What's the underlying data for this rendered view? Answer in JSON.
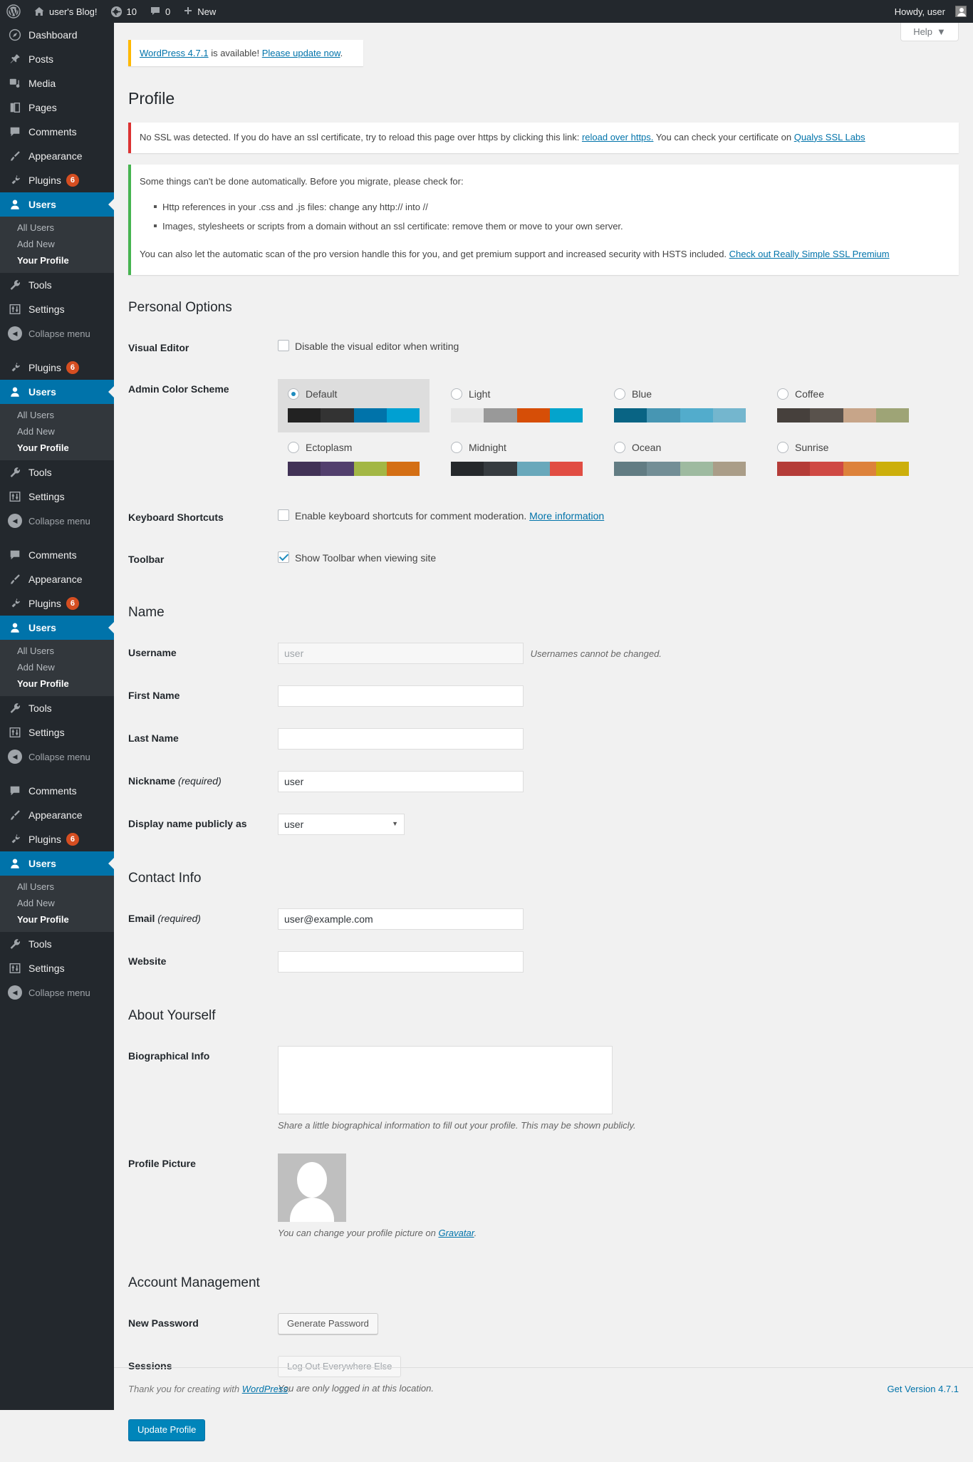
{
  "adminbar": {
    "site_name": "user's Blog!",
    "updates_count": "10",
    "comments_count": "0",
    "new_label": "New",
    "howdy": "Howdy, user"
  },
  "help_tab": {
    "label": "Help"
  },
  "sidebar": {
    "blocks": [
      {
        "items": [
          {
            "label": "Dashboard",
            "icon": "dashboard-icon",
            "current": false
          },
          {
            "label": "Posts",
            "icon": "posts-pin-icon",
            "current": false
          },
          {
            "label": "Media",
            "icon": "media-icon",
            "current": false
          },
          {
            "label": "Pages",
            "icon": "pages-icon",
            "current": false
          },
          {
            "label": "Comments",
            "icon": "comments-icon",
            "current": false
          },
          {
            "label": "Appearance",
            "icon": "appearance-brush-icon",
            "current": false
          },
          {
            "label": "Plugins",
            "icon": "plugins-plug-icon",
            "current": false,
            "badge": "6"
          },
          {
            "label": "Users",
            "icon": "users-icon",
            "current": true
          }
        ],
        "submenu": [
          {
            "label": "All Users",
            "current": false
          },
          {
            "label": "Add New",
            "current": false
          },
          {
            "label": "Your Profile",
            "current": true
          }
        ],
        "tail": [
          {
            "label": "Tools",
            "icon": "tools-wrench-icon"
          },
          {
            "label": "Settings",
            "icon": "settings-sliders-icon"
          }
        ],
        "collapse": "Collapse menu"
      },
      {
        "items": [
          {
            "label": "Plugins",
            "icon": "plugins-plug-icon",
            "current": false,
            "badge": "6"
          },
          {
            "label": "Users",
            "icon": "users-icon",
            "current": true
          }
        ],
        "submenu": [
          {
            "label": "All Users",
            "current": false
          },
          {
            "label": "Add New",
            "current": false
          },
          {
            "label": "Your Profile",
            "current": true
          }
        ],
        "tail": [
          {
            "label": "Tools",
            "icon": "tools-wrench-icon"
          },
          {
            "label": "Settings",
            "icon": "settings-sliders-icon"
          }
        ],
        "collapse": "Collapse menu"
      },
      {
        "items": [
          {
            "label": "Comments",
            "icon": "comments-icon",
            "current": false
          },
          {
            "label": "Appearance",
            "icon": "appearance-brush-icon",
            "current": false
          },
          {
            "label": "Plugins",
            "icon": "plugins-plug-icon",
            "current": false,
            "badge": "6"
          },
          {
            "label": "Users",
            "icon": "users-icon",
            "current": true
          }
        ],
        "submenu": [
          {
            "label": "All Users",
            "current": false
          },
          {
            "label": "Add New",
            "current": false
          },
          {
            "label": "Your Profile",
            "current": true
          }
        ],
        "tail": [
          {
            "label": "Tools",
            "icon": "tools-wrench-icon"
          },
          {
            "label": "Settings",
            "icon": "settings-sliders-icon"
          }
        ],
        "collapse": "Collapse menu"
      },
      {
        "items": [
          {
            "label": "Comments",
            "icon": "comments-icon",
            "current": false
          },
          {
            "label": "Appearance",
            "icon": "appearance-brush-icon",
            "current": false
          },
          {
            "label": "Plugins",
            "icon": "plugins-plug-icon",
            "current": false,
            "badge": "6"
          },
          {
            "label": "Users",
            "icon": "users-icon",
            "current": true
          }
        ],
        "submenu": [
          {
            "label": "All Users",
            "current": false
          },
          {
            "label": "Add New",
            "current": false
          },
          {
            "label": "Your Profile",
            "current": true
          }
        ],
        "tail": [
          {
            "label": "Tools",
            "icon": "tools-wrench-icon"
          },
          {
            "label": "Settings",
            "icon": "settings-sliders-icon"
          }
        ],
        "collapse": "Collapse menu"
      }
    ]
  },
  "update_nag": {
    "version_link": "WordPress 4.7.1",
    "middle": " is available! ",
    "update_link": "Please update now",
    "period": "."
  },
  "page_title": "Profile",
  "ssl_notice": {
    "text_before": "No SSL was detected. If you do have an ssl certificate, try to reload this page over https by clicking this link: ",
    "link1": "reload over https.",
    "text_middle": " You can check your certificate on ",
    "link2": "Qualys SSL Labs"
  },
  "migrate_notice": {
    "intro": "Some things can't be done automatically. Before you migrate, please check for:",
    "bullets": [
      "Http references in your .css and .js files: change any http:// into //",
      "Images, stylesheets or scripts from a domain without an ssl certificate: remove them or move to your own server."
    ],
    "outro": "You can also let the automatic scan of the pro version handle this for you, and get premium support and increased security with HSTS included. ",
    "premium_link": "Check out Really Simple SSL Premium"
  },
  "personal_options": {
    "heading": "Personal Options",
    "visual_editor": {
      "label": "Visual Editor",
      "checkbox_label": "Disable the visual editor when writing",
      "checked": false
    },
    "admin_color_scheme": {
      "label": "Admin Color Scheme",
      "schemes": [
        {
          "name": "Default",
          "selected": true,
          "colors": [
            "#222222",
            "#333333",
            "#0073aa",
            "#00a0d2"
          ]
        },
        {
          "name": "Light",
          "selected": false,
          "colors": [
            "#e5e5e5",
            "#999999",
            "#d64e07",
            "#04a4cc"
          ]
        },
        {
          "name": "Blue",
          "selected": false,
          "colors": [
            "#096484",
            "#4796b3",
            "#52accc",
            "#74B6CE"
          ]
        },
        {
          "name": "Coffee",
          "selected": false,
          "colors": [
            "#46403c",
            "#59524c",
            "#c7a589",
            "#9ea476"
          ]
        },
        {
          "name": "Ectoplasm",
          "selected": false,
          "colors": [
            "#413256",
            "#523f6d",
            "#a3b745",
            "#d46f15"
          ]
        },
        {
          "name": "Midnight",
          "selected": false,
          "colors": [
            "#25282b",
            "#363b3f",
            "#69a8bb",
            "#e14d43"
          ]
        },
        {
          "name": "Ocean",
          "selected": false,
          "colors": [
            "#627c83",
            "#738e96",
            "#9ebaa0",
            "#aa9d88"
          ]
        },
        {
          "name": "Sunrise",
          "selected": false,
          "colors": [
            "#b43c38",
            "#cf4944",
            "#dd823b",
            "#ccaf0b"
          ]
        }
      ]
    },
    "keyboard_shortcuts": {
      "label": "Keyboard Shortcuts",
      "checkbox_label": "Enable keyboard shortcuts for comment moderation.",
      "more_info": "More information",
      "checked": false
    },
    "toolbar": {
      "label": "Toolbar",
      "checkbox_label": "Show Toolbar when viewing site",
      "checked": true
    }
  },
  "name_section": {
    "heading": "Name",
    "username": {
      "label": "Username",
      "value": "user",
      "note": "Usernames cannot be changed."
    },
    "first_name": {
      "label": "First Name",
      "value": ""
    },
    "last_name": {
      "label": "Last Name",
      "value": ""
    },
    "nickname": {
      "label": "Nickname ",
      "required": "(required)",
      "value": "user"
    },
    "display_name": {
      "label": "Display name publicly as",
      "value": "user",
      "options": [
        "user"
      ]
    }
  },
  "contact_section": {
    "heading": "Contact Info",
    "email": {
      "label": "Email ",
      "required": "(required)",
      "value": "user@example.com"
    },
    "website": {
      "label": "Website",
      "value": ""
    }
  },
  "about_section": {
    "heading": "About Yourself",
    "bio": {
      "label": "Biographical Info",
      "value": "",
      "description": "Share a little biographical information to fill out your profile. This may be shown publicly."
    },
    "profile_picture": {
      "label": "Profile Picture",
      "description_before": "You can change your profile picture on ",
      "gravatar_link": "Gravatar",
      "description_after": "."
    }
  },
  "account_section": {
    "heading": "Account Management",
    "new_password": {
      "label": "New Password",
      "button": "Generate Password"
    },
    "sessions": {
      "label": "Sessions",
      "button": "Log Out Everywhere Else",
      "description": "You are only logged in at this location."
    }
  },
  "submit": {
    "label": "Update Profile"
  },
  "footer": {
    "thanks_before": "Thank you for creating with ",
    "wordpress_link": "WordPress",
    "thanks_after": ".",
    "version": "Get Version 4.7.1"
  }
}
